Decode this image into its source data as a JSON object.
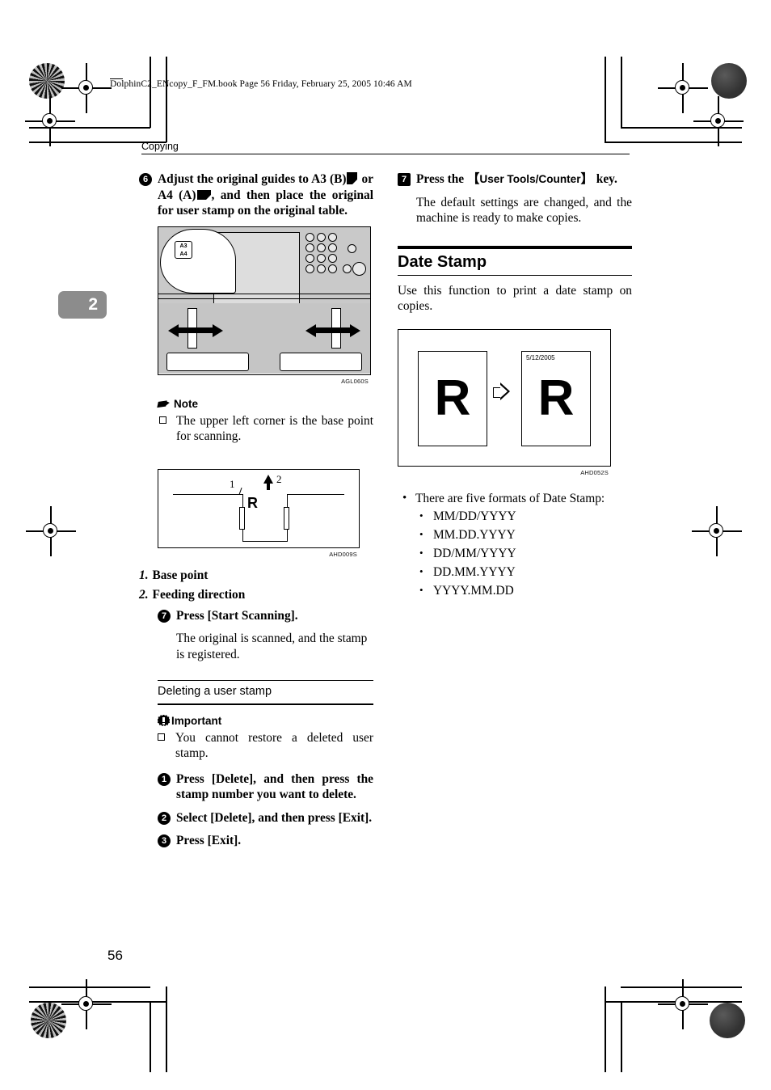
{
  "file_header": "DolphinC2_ENcopy_F_FM.book  Page 56  Friday, February 25, 2005  10:46 AM",
  "running_head": "Copying",
  "chapter_tab": "2",
  "page_number": "56",
  "left_column": {
    "step6": {
      "marker": "6",
      "text_parts": {
        "a": "Adjust the original guides to A3 (B)",
        "b": " or A4 (A)",
        "c": ", and then place the original for user stamp on the original table."
      }
    },
    "figure_copier": {
      "code": "AGL060S",
      "callout_top": "A3",
      "callout_bottom": "A4"
    },
    "note": {
      "title": "Note",
      "items": [
        "The upper left corner is the base point for scanning."
      ]
    },
    "figure_basepoint": {
      "code": "AHD009S",
      "label_1": "1",
      "label_2": "2",
      "letter": "R"
    },
    "legend": [
      {
        "num": "1.",
        "text": "Base point"
      },
      {
        "num": "2.",
        "text": "Feeding direction"
      }
    ],
    "step7": {
      "marker": "7",
      "text": "Press [Start Scanning].",
      "body": "The original is scanned, and the stamp is registered."
    },
    "subsection": {
      "title": "Deleting a user stamp",
      "important": {
        "title": "Important",
        "items": [
          "You cannot restore a deleted user stamp."
        ]
      },
      "steps": [
        {
          "marker": "1",
          "text": "Press [Delete], and then press the stamp number you want to delete."
        },
        {
          "marker": "2",
          "text": "Select [Delete], and then press [Exit]."
        },
        {
          "marker": "3",
          "text": "Press [Exit]."
        }
      ]
    }
  },
  "right_column": {
    "step7": {
      "marker": "7",
      "text_before": "Press the ",
      "key_label": "User Tools/Counter",
      "text_after": " key.",
      "body": "The default settings are changed, and the machine is ready to make copies."
    },
    "section": {
      "heading": "Date Stamp",
      "intro": "Use this function to print a date stamp on copies."
    },
    "figure_datestamp": {
      "code": "AHD052S",
      "letter": "R",
      "date": "5/12/2005"
    },
    "formats_intro": "There are five formats of Date Stamp:",
    "formats": [
      "MM/DD/YYYY",
      "MM.DD.YYYY",
      "DD/MM/YYYY",
      "DD.MM.YYYY",
      "YYYY.MM.DD"
    ]
  }
}
